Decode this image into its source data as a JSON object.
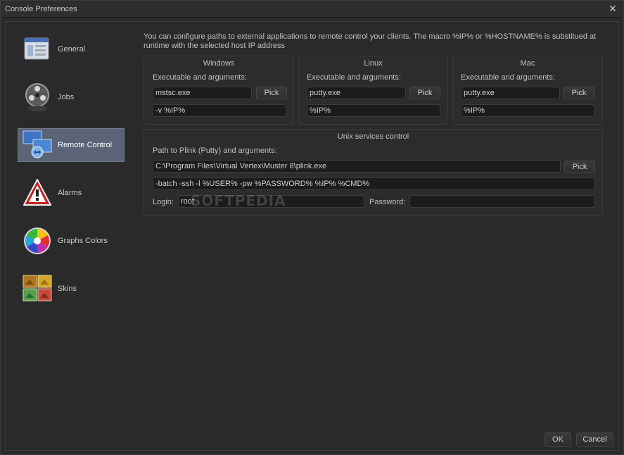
{
  "window": {
    "title": "Console Preferences"
  },
  "sidebar": {
    "items": [
      {
        "label": "General",
        "icon": "window-icon"
      },
      {
        "label": "Jobs",
        "icon": "film-reel-icon"
      },
      {
        "label": "Remote Control",
        "icon": "network-icon",
        "selected": true
      },
      {
        "label": "Alarms",
        "icon": "warning-icon"
      },
      {
        "label": "Graphs Colors",
        "icon": "color-wheel-icon"
      },
      {
        "label": "Skins",
        "icon": "skins-icon"
      }
    ]
  },
  "remote": {
    "intro_line1": "You can configure paths to external applications to remote control your clients. The macro %IP% or %HOSTNAME% is substitued at",
    "intro_line2": "runtime with the selected host IP address",
    "windows": {
      "title": "Windows",
      "exe_label": "Executable and arguments:",
      "exe": "mstsc.exe",
      "args": "-v %IP%",
      "pick": "Pick"
    },
    "linux": {
      "title": "Linux",
      "exe_label": "Executable and arguments:",
      "exe": "putty.exe",
      "args": "%IP%",
      "pick": "Pick"
    },
    "mac": {
      "title": "Mac",
      "exe_label": "Executable and arguments:",
      "exe": "putty.exe",
      "args": "%IP%",
      "pick": "Pick"
    },
    "unix": {
      "title": "Unix services control",
      "path_label": "Path to Plink (Putty) and arguments:",
      "path": "C:\\Program Files\\Virtual Vertex\\Muster 8\\plink.exe",
      "pick": "Pick",
      "args": "-batch -ssh -l %USER% -pw %PASSWORD% %IP% %CMD%",
      "login_label": "Login:",
      "login": "root",
      "password_label": "Password:",
      "password": ""
    }
  },
  "watermark": "SOFTPEDIA",
  "footer": {
    "ok": "OK",
    "cancel": "Cancel"
  }
}
